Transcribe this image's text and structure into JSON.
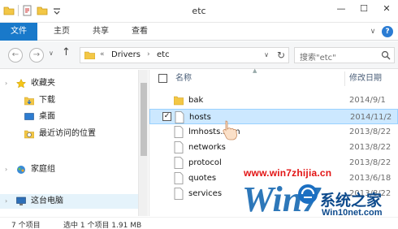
{
  "window": {
    "title": "etc",
    "minimize": "—",
    "maximize": "☐",
    "close": "✕"
  },
  "ribbon": {
    "tabs": [
      {
        "label": "文件"
      },
      {
        "label": "主页"
      },
      {
        "label": "共享"
      },
      {
        "label": "查看"
      }
    ],
    "collapse": "∨",
    "help": "?"
  },
  "nav": {
    "back": "←",
    "forward": "→",
    "recent": "∨",
    "up": "↑",
    "breadcrumb": {
      "overflow": "«",
      "items": [
        "Drivers",
        "etc"
      ],
      "separator": "›"
    },
    "dropdown": "∨",
    "refresh": "↻",
    "search_placeholder": "搜索\"etc\""
  },
  "sidebar": {
    "items": [
      {
        "label": "收藏夹",
        "icon": "star-icon"
      },
      {
        "label": "下载",
        "icon": "download-folder-icon"
      },
      {
        "label": "桌面",
        "icon": "desktop-icon"
      },
      {
        "label": "最近访问的位置",
        "icon": "recent-places-icon"
      },
      {
        "label": "家庭组",
        "icon": "homegroup-icon"
      },
      {
        "label": "这台电脑",
        "icon": "this-pc-icon"
      }
    ],
    "collapse_arrow": "›"
  },
  "columns": {
    "name": "名称",
    "date": "修改日期"
  },
  "files": [
    {
      "name": "bak",
      "date": "2014/9/1",
      "type": "folder"
    },
    {
      "name": "hosts",
      "date": "2014/11/2",
      "type": "file",
      "selected": true,
      "checkbox": "✓"
    },
    {
      "name": "lmhosts.sam",
      "date": "2013/8/22",
      "type": "file"
    },
    {
      "name": "networks",
      "date": "2013/8/22",
      "type": "file"
    },
    {
      "name": "protocol",
      "date": "2013/8/22",
      "type": "file"
    },
    {
      "name": "quotes",
      "date": "2013/6/18",
      "type": "file"
    },
    {
      "name": "services",
      "date": "2013/8/22",
      "type": "file"
    }
  ],
  "status": {
    "count": "7 个项目",
    "selection": "选中 1 个项目  1.91 MB"
  },
  "watermark": {
    "url": "www.win7zhijia.cn",
    "big": "Win7",
    "brand": "系统之家",
    "brand_url": "Win10net.com"
  },
  "colors": {
    "accent": "#1979ca",
    "selection": "#cce8ff",
    "watermark_red": "#e21414",
    "watermark_blue": "#1769b2"
  }
}
